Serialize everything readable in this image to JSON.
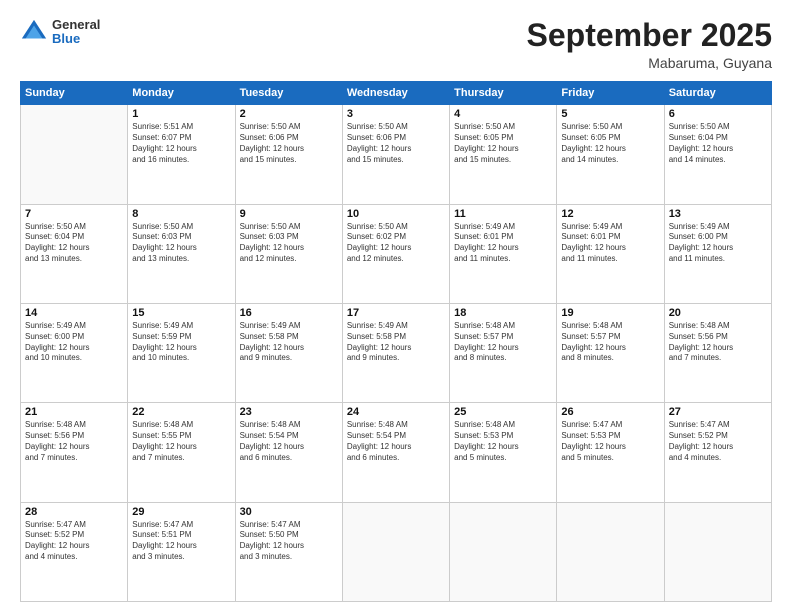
{
  "header": {
    "logo": {
      "line1": "General",
      "line2": "Blue"
    },
    "title": "September 2025",
    "subtitle": "Mabaruma, Guyana"
  },
  "days_of_week": [
    "Sunday",
    "Monday",
    "Tuesday",
    "Wednesday",
    "Thursday",
    "Friday",
    "Saturday"
  ],
  "weeks": [
    [
      {
        "day": "",
        "info": ""
      },
      {
        "day": "1",
        "info": "Sunrise: 5:51 AM\nSunset: 6:07 PM\nDaylight: 12 hours\nand 16 minutes."
      },
      {
        "day": "2",
        "info": "Sunrise: 5:50 AM\nSunset: 6:06 PM\nDaylight: 12 hours\nand 15 minutes."
      },
      {
        "day": "3",
        "info": "Sunrise: 5:50 AM\nSunset: 6:06 PM\nDaylight: 12 hours\nand 15 minutes."
      },
      {
        "day": "4",
        "info": "Sunrise: 5:50 AM\nSunset: 6:05 PM\nDaylight: 12 hours\nand 15 minutes."
      },
      {
        "day": "5",
        "info": "Sunrise: 5:50 AM\nSunset: 6:05 PM\nDaylight: 12 hours\nand 14 minutes."
      },
      {
        "day": "6",
        "info": "Sunrise: 5:50 AM\nSunset: 6:04 PM\nDaylight: 12 hours\nand 14 minutes."
      }
    ],
    [
      {
        "day": "7",
        "info": "Sunrise: 5:50 AM\nSunset: 6:04 PM\nDaylight: 12 hours\nand 13 minutes."
      },
      {
        "day": "8",
        "info": "Sunrise: 5:50 AM\nSunset: 6:03 PM\nDaylight: 12 hours\nand 13 minutes."
      },
      {
        "day": "9",
        "info": "Sunrise: 5:50 AM\nSunset: 6:03 PM\nDaylight: 12 hours\nand 12 minutes."
      },
      {
        "day": "10",
        "info": "Sunrise: 5:50 AM\nSunset: 6:02 PM\nDaylight: 12 hours\nand 12 minutes."
      },
      {
        "day": "11",
        "info": "Sunrise: 5:49 AM\nSunset: 6:01 PM\nDaylight: 12 hours\nand 11 minutes."
      },
      {
        "day": "12",
        "info": "Sunrise: 5:49 AM\nSunset: 6:01 PM\nDaylight: 12 hours\nand 11 minutes."
      },
      {
        "day": "13",
        "info": "Sunrise: 5:49 AM\nSunset: 6:00 PM\nDaylight: 12 hours\nand 11 minutes."
      }
    ],
    [
      {
        "day": "14",
        "info": "Sunrise: 5:49 AM\nSunset: 6:00 PM\nDaylight: 12 hours\nand 10 minutes."
      },
      {
        "day": "15",
        "info": "Sunrise: 5:49 AM\nSunset: 5:59 PM\nDaylight: 12 hours\nand 10 minutes."
      },
      {
        "day": "16",
        "info": "Sunrise: 5:49 AM\nSunset: 5:58 PM\nDaylight: 12 hours\nand 9 minutes."
      },
      {
        "day": "17",
        "info": "Sunrise: 5:49 AM\nSunset: 5:58 PM\nDaylight: 12 hours\nand 9 minutes."
      },
      {
        "day": "18",
        "info": "Sunrise: 5:48 AM\nSunset: 5:57 PM\nDaylight: 12 hours\nand 8 minutes."
      },
      {
        "day": "19",
        "info": "Sunrise: 5:48 AM\nSunset: 5:57 PM\nDaylight: 12 hours\nand 8 minutes."
      },
      {
        "day": "20",
        "info": "Sunrise: 5:48 AM\nSunset: 5:56 PM\nDaylight: 12 hours\nand 7 minutes."
      }
    ],
    [
      {
        "day": "21",
        "info": "Sunrise: 5:48 AM\nSunset: 5:56 PM\nDaylight: 12 hours\nand 7 minutes."
      },
      {
        "day": "22",
        "info": "Sunrise: 5:48 AM\nSunset: 5:55 PM\nDaylight: 12 hours\nand 7 minutes."
      },
      {
        "day": "23",
        "info": "Sunrise: 5:48 AM\nSunset: 5:54 PM\nDaylight: 12 hours\nand 6 minutes."
      },
      {
        "day": "24",
        "info": "Sunrise: 5:48 AM\nSunset: 5:54 PM\nDaylight: 12 hours\nand 6 minutes."
      },
      {
        "day": "25",
        "info": "Sunrise: 5:48 AM\nSunset: 5:53 PM\nDaylight: 12 hours\nand 5 minutes."
      },
      {
        "day": "26",
        "info": "Sunrise: 5:47 AM\nSunset: 5:53 PM\nDaylight: 12 hours\nand 5 minutes."
      },
      {
        "day": "27",
        "info": "Sunrise: 5:47 AM\nSunset: 5:52 PM\nDaylight: 12 hours\nand 4 minutes."
      }
    ],
    [
      {
        "day": "28",
        "info": "Sunrise: 5:47 AM\nSunset: 5:52 PM\nDaylight: 12 hours\nand 4 minutes."
      },
      {
        "day": "29",
        "info": "Sunrise: 5:47 AM\nSunset: 5:51 PM\nDaylight: 12 hours\nand 3 minutes."
      },
      {
        "day": "30",
        "info": "Sunrise: 5:47 AM\nSunset: 5:50 PM\nDaylight: 12 hours\nand 3 minutes."
      },
      {
        "day": "",
        "info": ""
      },
      {
        "day": "",
        "info": ""
      },
      {
        "day": "",
        "info": ""
      },
      {
        "day": "",
        "info": ""
      }
    ]
  ]
}
